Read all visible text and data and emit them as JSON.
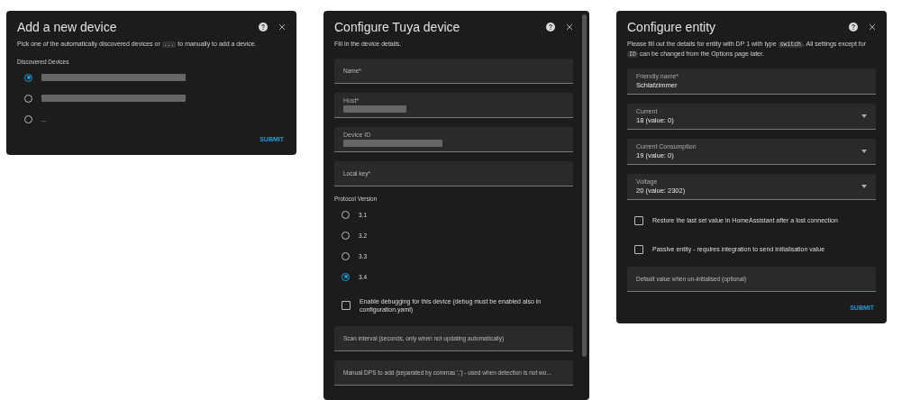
{
  "dialogs": [
    {
      "title": "Add a new device",
      "description": [
        {
          "kind": "text",
          "text": "Pick one of the automatically discovered devices or "
        },
        {
          "kind": "code",
          "text": "..."
        },
        {
          "kind": "text",
          "text": " to manually to add a device."
        }
      ],
      "sections": [
        {
          "kind": "radio_group",
          "label": "Discovered Devices",
          "options": [
            {
              "masked": true,
              "selected": true
            },
            {
              "masked": true,
              "selected": false
            },
            {
              "label": "...",
              "selected": false
            }
          ]
        }
      ],
      "submit": "SUBMIT"
    },
    {
      "title": "Configure Tuya device",
      "description": [
        {
          "kind": "text",
          "text": "Fill in the device details."
        }
      ],
      "sections": [
        {
          "kind": "field",
          "label": "Name*"
        },
        {
          "kind": "field",
          "label": "Host*",
          "masked": true
        },
        {
          "kind": "field",
          "label": "Device ID",
          "masked": true
        },
        {
          "kind": "field",
          "label": "Local key*"
        },
        {
          "kind": "radio_group",
          "label": "Protocol Version",
          "options": [
            {
              "label": "3.1",
              "selected": false
            },
            {
              "label": "3.2",
              "selected": false
            },
            {
              "label": "3.3",
              "selected": false
            },
            {
              "label": "3.4",
              "selected": true
            }
          ]
        },
        {
          "kind": "checkbox",
          "label": "Enable debugging for this device (debug must be enabled also in configuration.yaml)",
          "checked": false
        },
        {
          "kind": "field",
          "label": "Scan interval (seconds, only when not updating automatically)"
        },
        {
          "kind": "field",
          "label": "Manual DPS to add (separated by commas ',') - used when detection is not wo..."
        }
      ],
      "scrollbar": true
    },
    {
      "title": "Configure entity",
      "description": [
        {
          "kind": "text",
          "text": "Please fill out the details for entity with DP 1 with type "
        },
        {
          "kind": "code",
          "text": "switch"
        },
        {
          "kind": "text",
          "text": ". All settings except for "
        },
        {
          "kind": "code",
          "text": "ID"
        },
        {
          "kind": "text",
          "text": " can be changed from the Options page later."
        }
      ],
      "sections": [
        {
          "kind": "field",
          "label": "Friendly name*",
          "value": "Schlafzimmer"
        },
        {
          "kind": "select",
          "label": "Current",
          "value": "18 (value: 0)"
        },
        {
          "kind": "select",
          "label": "Current Consumption",
          "value": "19 (value: 0)"
        },
        {
          "kind": "select",
          "label": "Voltage",
          "value": "20 (value: 2302)"
        },
        {
          "kind": "checkbox",
          "label": "Restore the last set value in HomeAssistant after a lost connection",
          "checked": false
        },
        {
          "kind": "checkbox",
          "label": "Passive entity - requires integration to send initialisation value",
          "checked": false
        },
        {
          "kind": "field",
          "label": "Default value when un-initialised (optional)"
        }
      ],
      "submit": "SUBMIT"
    }
  ]
}
